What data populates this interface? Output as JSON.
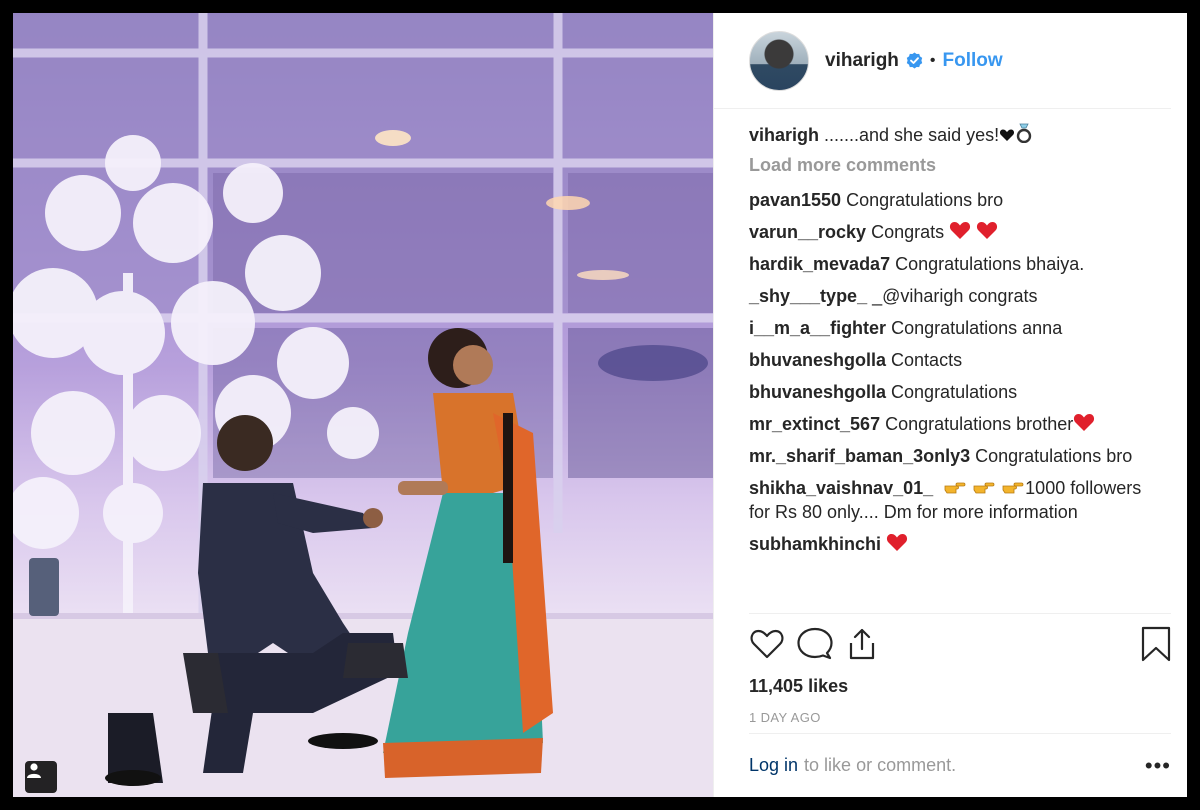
{
  "post": {
    "username": "viharigh",
    "follow_label": "Follow",
    "separator": "•",
    "caption": {
      "user": "viharigh",
      "text": ".......and she said yes!"
    },
    "load_more_label": "Load more comments",
    "comments": [
      {
        "user": "pavan1550",
        "text": "Congratulations bro"
      },
      {
        "user": "varun__rocky",
        "text": "Congrats"
      },
      {
        "user": "hardik_mevada7",
        "text": "Congratulations bhaiya."
      },
      {
        "user": "_shy___type_",
        "text": "_@viharigh congrats"
      },
      {
        "user": "i__m_a__fighter",
        "text": "Congratulations anna"
      },
      {
        "user": "bhuvaneshgolla",
        "text": "Contacts"
      },
      {
        "user": "bhuvaneshgolla",
        "text": "Congratulations"
      },
      {
        "user": "mr_extinct_567",
        "text": "Congratulations brother"
      },
      {
        "user": "mr._sharif_baman_3only3",
        "text": "Congratulations bro"
      },
      {
        "user": "shikha_vaishnav_01_",
        "text": "1000 followers for Rs 80 only.... Dm for more information"
      },
      {
        "user": "subhamkhinchi",
        "text": ""
      }
    ],
    "likes": "11,405 likes",
    "time": "1 DAY AGO",
    "login_label": "Log in",
    "login_suffix": "to like or comment.",
    "more_options": "•••"
  },
  "icons": {
    "heart": "heart-icon",
    "comment": "comment-icon",
    "share": "share-icon",
    "bookmark": "bookmark-icon",
    "verified": "verified-badge-icon",
    "user_tag": "user-tag-icon"
  },
  "colors": {
    "link_blue": "#3897f0",
    "verified_blue": "#3897f0",
    "heart_red": "#e0202c",
    "muted": "#999999",
    "text": "#262626"
  }
}
